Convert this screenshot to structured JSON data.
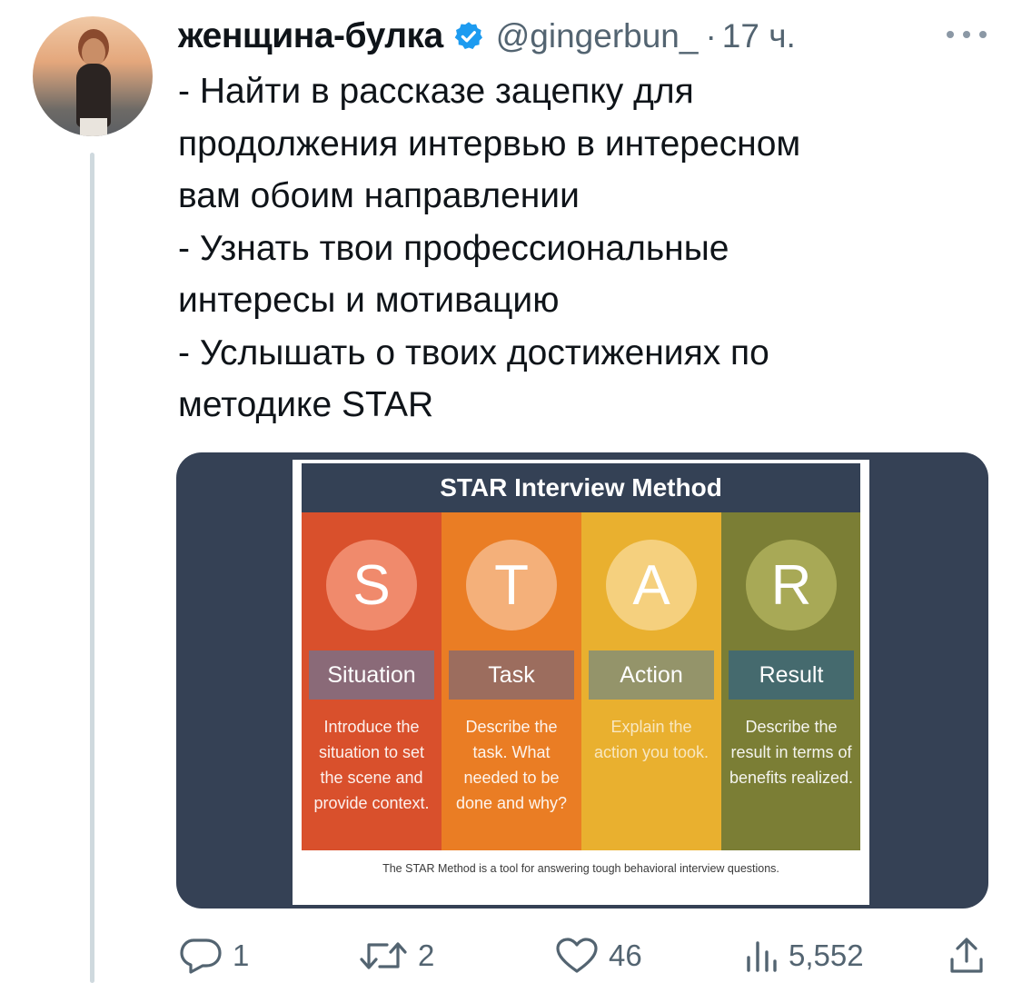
{
  "author": {
    "display_name": "женщина-булка",
    "handle": "@gingerbun_",
    "separator": "·",
    "time": "17 ч."
  },
  "tweet": {
    "lines": [
      "- Найти в рассказе зацепку для",
      "продолжения интервью в интересном",
      "вам обоим направлении",
      "- Узнать твои профессиональные",
      "интересы и мотивацию",
      "- Услышать о твоих достижениях по",
      "методике STAR"
    ]
  },
  "media": {
    "title": "STAR Interview Method",
    "steps": [
      {
        "letter": "S",
        "label": "Situation",
        "description": "Introduce the situation to set the scene and provide context."
      },
      {
        "letter": "T",
        "label": "Task",
        "description": "Describe the task. What needed to be done and why?"
      },
      {
        "letter": "A",
        "label": "Action",
        "description": "Explain the action you took."
      },
      {
        "letter": "R",
        "label": "Result",
        "description": "Describe the result in terms of benefits realized."
      }
    ],
    "caption": "The STAR Method is a tool for answering tough behavioral interview questions."
  },
  "actions": {
    "replies": "1",
    "retweets": "2",
    "likes": "46",
    "views": "5,552"
  },
  "colors": {
    "verified": "#1d9bf0",
    "muted_text": "#536471",
    "image_background": "#354155"
  },
  "icons": [
    "verified-badge-icon",
    "more-dots-icon",
    "reply-icon",
    "retweet-icon",
    "like-icon",
    "views-icon",
    "share-icon"
  ]
}
